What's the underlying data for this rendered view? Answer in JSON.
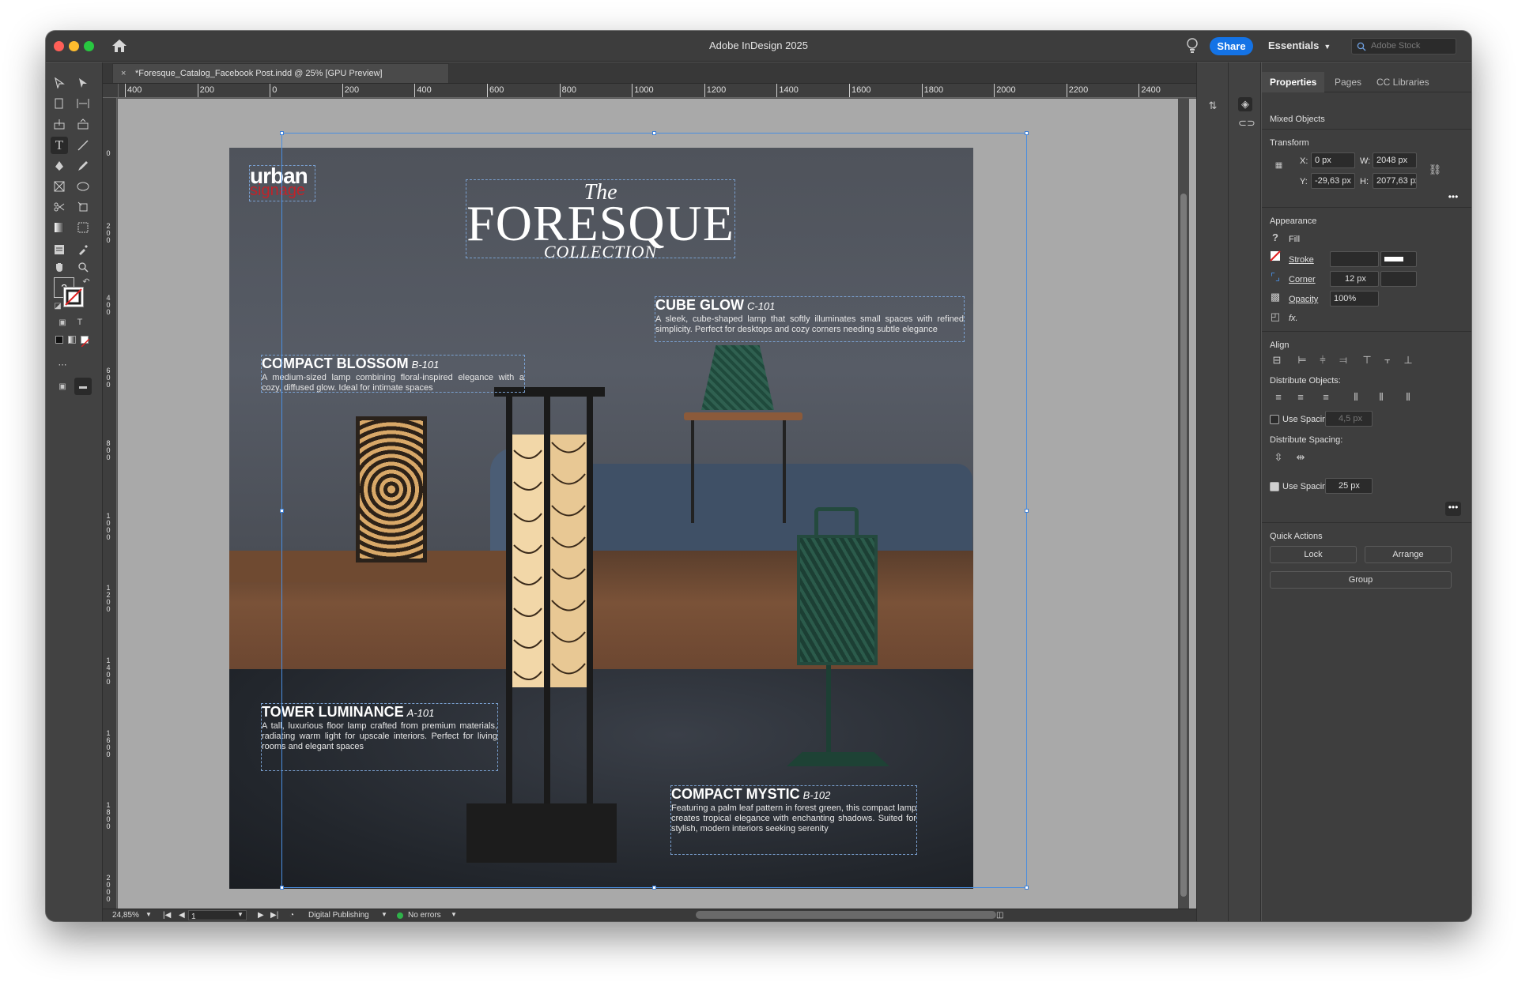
{
  "app": {
    "title": "Adobe InDesign 2025",
    "share_label": "Share",
    "workspace_label": "Essentials",
    "stock_placeholder": "Adobe Stock"
  },
  "document": {
    "tab_title": "*Foresque_Catalog_Facebook Post.indd @ 25% [GPU Preview]",
    "close_glyph": "×"
  },
  "rulers": {
    "horizontal": [
      "400",
      "200",
      "0",
      "200",
      "400",
      "600",
      "800",
      "1000",
      "1200",
      "1400",
      "1600",
      "1800",
      "2000",
      "2200",
      "2400"
    ],
    "vertical": [
      "0",
      "200",
      "400",
      "600",
      "800",
      "1000",
      "1200",
      "1400",
      "1600",
      "1800",
      "2000"
    ]
  },
  "page": {
    "logo_word1": "urban",
    "logo_word2": "signage",
    "header_the": "The",
    "header_main": "FORESQUE",
    "header_collection": "COLLECTION",
    "products": [
      {
        "name": "CUBE GLOW",
        "code": "C-101",
        "desc": "A sleek, cube-shaped lamp that softly illuminates small spaces with refined simplicity. Perfect for desktops and cozy corners needing subtle elegance"
      },
      {
        "name": "COMPACT BLOSSOM",
        "code": "B-101",
        "desc": "A medium-sized lamp combining floral-inspired elegance with a cozy, diffused glow. Ideal for intimate spaces"
      },
      {
        "name": "TOWER LUMINANCE",
        "code": "A-101",
        "desc": "A tall, luxurious floor lamp crafted from premium materials, radiating warm light for upscale interiors. Perfect for living rooms and elegant spaces"
      },
      {
        "name": "COMPACT MYSTIC",
        "code": "B-102",
        "desc": "Featuring a palm leaf pattern in forest green, this compact lamp creates tropical elegance with enchanting shadows. Suited for stylish, modern interiors seeking serenity"
      }
    ]
  },
  "status": {
    "zoom": "24,85%",
    "page_number": "1",
    "profile": "Digital Publishing",
    "errors": "No errors"
  },
  "panel": {
    "tabs": [
      "Properties",
      "Pages",
      "CC Libraries"
    ],
    "selection": "Mixed Objects",
    "transform": {
      "title": "Transform",
      "x_label": "X:",
      "x_value": "0 px",
      "y_label": "Y:",
      "y_value": "-29,63 px",
      "w_label": "W:",
      "w_value": "2048 px",
      "h_label": "H:",
      "h_value": "2077,63 px"
    },
    "appearance": {
      "title": "Appearance",
      "fill_label": "Fill",
      "fill_glyph": "?",
      "stroke_label": "Stroke",
      "corner_label": "Corner",
      "corner_value": "12 px",
      "opacity_label": "Opacity",
      "opacity_value": "100%",
      "fx_label": "fx."
    },
    "align": {
      "title": "Align",
      "distribute_objects": "Distribute Objects:",
      "use_spacing_label": "Use Spacing",
      "spacing1_value": "4,5 px",
      "distribute_spacing": "Distribute Spacing:",
      "use_spacing2_label": "Use Spacing",
      "spacing2_value": "25 px"
    },
    "quick_actions": {
      "title": "Quick Actions",
      "lock": "Lock",
      "arrange": "Arrange",
      "group": "Group"
    }
  },
  "colors": {
    "accent": "#1473e6",
    "logo_red": "#c0232a",
    "panel_bg": "#3e3e3e",
    "pasteboard": "#a9a9a9"
  }
}
